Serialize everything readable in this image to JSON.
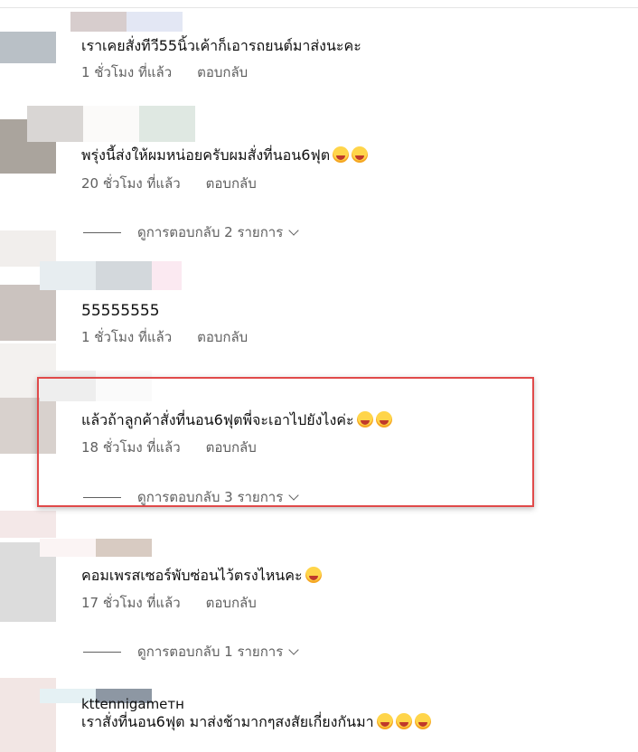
{
  "comments": [
    {
      "text": "เราเคยสั่งทีวี55นิ้วเค้าก็เอารถยนต์มาส่งนะคะ",
      "time": "1 ชั่วโมง ที่แล้ว",
      "reply": "ตอบกลับ"
    },
    {
      "text": "พรุ่งนี้ส่งให้ผมหน่อยครับผมสั่งที่นอน6ฟุต",
      "time": "20 ชั่วโมง ที่แล้ว",
      "reply": "ตอบกลับ",
      "view_replies": "ดูการตอบกลับ 2 รายการ"
    },
    {
      "text": "55555555",
      "time": "1 ชั่วโมง ที่แล้ว",
      "reply": "ตอบกลับ"
    },
    {
      "text": "แล้วถ้าลูกค้าสั่งที่นอน6ฟุตพี่จะเอาไปยังไงค่ะ",
      "time": "18 ชั่วโมง ที่แล้ว",
      "reply": "ตอบกลับ",
      "view_replies": "ดูการตอบกลับ 3 รายการ"
    },
    {
      "text": "คอมเพรสเซอร์พับซ่อนไว้ตรงไหนคะ",
      "time": "17 ชั่วโมง ที่แล้ว",
      "reply": "ตอบกลับ",
      "view_replies": "ดูการตอบกลับ 1 รายการ"
    },
    {
      "author": "kttennigameтн",
      "text": "เราสั่งที่นอน6ฟุต มาส่งช้ามากๆสงสัยเกี่ยงกันมา"
    }
  ],
  "emoji_names": [
    "grinning-face-icon",
    "rolling-laughing-face-icon",
    "sweat-smile-face-icon"
  ],
  "colors": {
    "highlight": "#e04a4a",
    "meta": "#606060"
  }
}
